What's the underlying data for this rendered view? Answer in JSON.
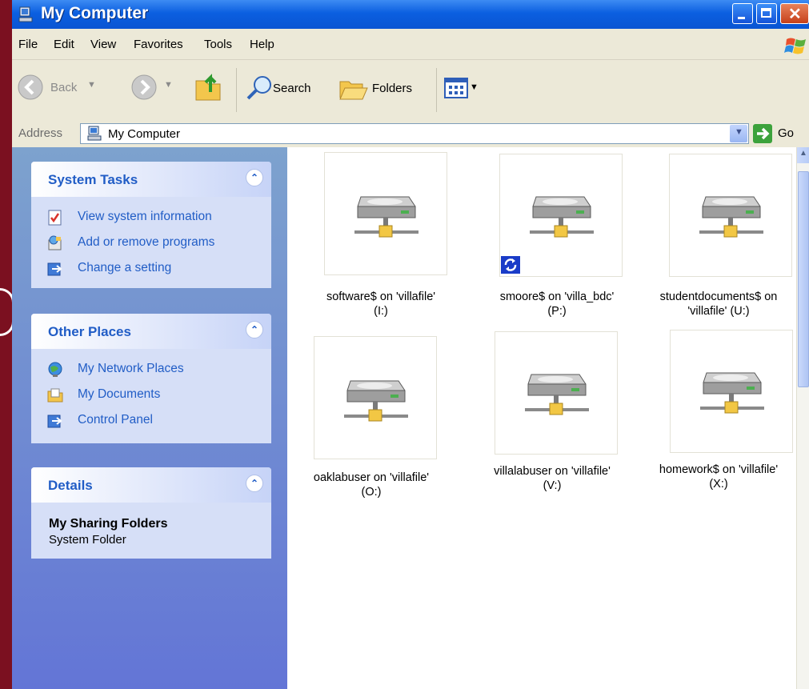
{
  "window": {
    "title": "My Computer"
  },
  "menu": [
    "File",
    "Edit",
    "View",
    "Favorites",
    "Tools",
    "Help"
  ],
  "toolbar": {
    "back_label": "Back",
    "search_label": "Search",
    "folders_label": "Folders"
  },
  "address": {
    "label": "Address",
    "value": "My Computer",
    "go_label": "Go"
  },
  "tasks_pane": {
    "system_tasks": {
      "title": "System Tasks",
      "items": [
        "View system information",
        "Add or remove programs",
        "Change a setting"
      ]
    },
    "other_places": {
      "title": "Other Places",
      "items": [
        "My Network Places",
        "My Documents",
        "Control Panel"
      ]
    },
    "details": {
      "title": "Details",
      "name": "My Sharing Folders",
      "type": "System Folder"
    }
  },
  "drives": [
    {
      "line1": "software$ on 'villafile'",
      "line2": "(I:)"
    },
    {
      "line1": "smoore$ on 'villa_bdc'",
      "line2": "(P:)"
    },
    {
      "line1": "studentdocuments$ on",
      "line2": "'villafile' (U:)"
    },
    {
      "line1": "oaklabuser on 'villafile'",
      "line2": "(O:)"
    },
    {
      "line1": "villalabuser on 'villafile'",
      "line2": "(V:)"
    },
    {
      "line1": "homework$ on 'villafile'",
      "line2": "(X:)"
    }
  ],
  "colors": {
    "titlebar": "#0a55d3",
    "taskpane": "#6e8bd6",
    "link": "#215dc6",
    "background": "#7b1020"
  }
}
